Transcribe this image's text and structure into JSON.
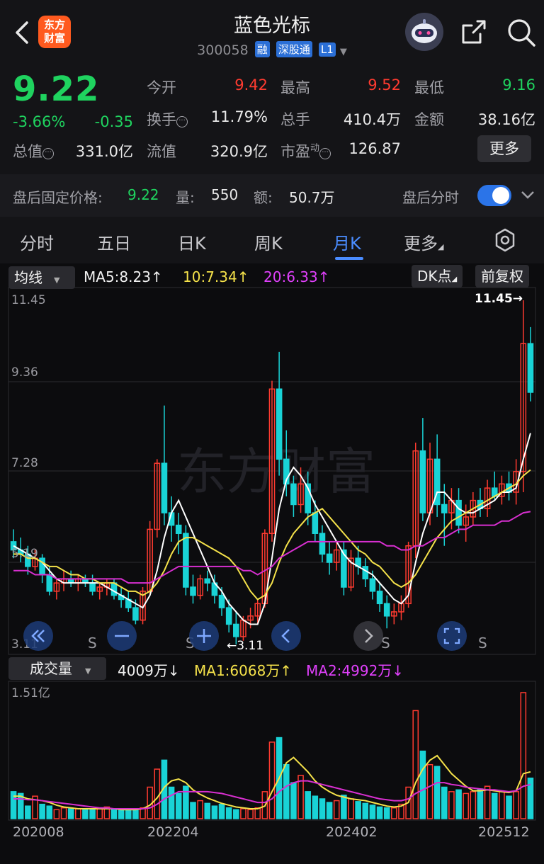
{
  "header": {
    "logo_line1": "东方",
    "logo_line2": "财富",
    "stock_name": "蓝色光标",
    "stock_code": "300058",
    "tags": [
      "融",
      "深股通",
      "L1"
    ]
  },
  "quote": {
    "price": "9.22",
    "change_pct": "-3.66%",
    "change_amt": "-0.35",
    "open_label": "今开",
    "open": "9.42",
    "high_label": "最高",
    "high": "9.52",
    "low_label": "最低",
    "low": "9.16",
    "turnover_label": "换手",
    "turnover": "11.79%",
    "volume_label": "总手",
    "volume": "410.4万",
    "amount_label": "金额",
    "amount": "38.16亿",
    "mktcap_label": "总值",
    "mktcap": "331.0亿",
    "float_label": "流值",
    "float_cap": "320.9亿",
    "pe_label": "市盈",
    "pe_sup": "动",
    "pe": "126.87",
    "more_label": "更多"
  },
  "after_hours": {
    "price_label": "盘后固定价格:",
    "price": "9.22",
    "vol_label": "量:",
    "vol": "550",
    "amt_label": "额:",
    "amt": "50.7万",
    "timeshare_label": "盘后分时"
  },
  "tabs": [
    "分时",
    "五日",
    "日K",
    "周K",
    "月K",
    "更多"
  ],
  "active_tab": "月K",
  "chart_toolbar": {
    "indicator": "均线",
    "ma5": "MA5:8.23↑",
    "ma10": "10:7.34↑",
    "ma20": "20:6.33↑",
    "dk_label": "DK点",
    "adjust_label": "前复权"
  },
  "volume_toolbar": {
    "indicator": "成交量",
    "vol": "4009万↓",
    "ma1": "MA1:6068万↑",
    "ma2": "MA2:4992万↓"
  },
  "colors": {
    "up": "#ff3b30",
    "down": "#19d3d6",
    "ma5": "#ffffff",
    "ma10": "#f5e24a",
    "ma20": "#d82fd0"
  },
  "chart_data": [
    {
      "type": "candlestick",
      "price_axis_labels": [
        "11.45",
        "9.36",
        "7.28",
        "5.19",
        "3.11"
      ],
      "ylim": [
        3.11,
        11.45
      ],
      "max_marker": "11.45→",
      "min_marker": "←3.11",
      "signal_marker": "S",
      "x_labels": [
        "202008",
        "202204",
        "202402",
        "202512"
      ],
      "candles": [
        [
          5.6,
          5.9,
          5.2,
          5.4
        ],
        [
          5.4,
          5.7,
          5.1,
          5.3
        ],
        [
          5.3,
          5.5,
          4.8,
          5.0
        ],
        [
          5.0,
          5.4,
          4.9,
          5.2
        ],
        [
          5.2,
          5.3,
          4.6,
          4.8
        ],
        [
          4.8,
          5.0,
          4.3,
          4.4
        ],
        [
          4.4,
          4.7,
          4.2,
          4.6
        ],
        [
          4.6,
          4.9,
          4.4,
          4.7
        ],
        [
          4.7,
          4.9,
          4.5,
          4.6
        ],
        [
          4.6,
          4.8,
          4.4,
          4.7
        ],
        [
          4.7,
          4.8,
          4.5,
          4.6
        ],
        [
          4.6,
          4.8,
          4.3,
          4.4
        ],
        [
          4.4,
          4.6,
          4.2,
          4.5
        ],
        [
          4.5,
          4.7,
          4.3,
          4.6
        ],
        [
          4.6,
          4.7,
          4.2,
          4.3
        ],
        [
          4.3,
          4.5,
          4.0,
          4.2
        ],
        [
          4.2,
          4.4,
          3.9,
          4.0
        ],
        [
          4.0,
          4.2,
          3.6,
          3.7
        ],
        [
          3.7,
          4.5,
          3.6,
          4.4
        ],
        [
          4.4,
          6.1,
          4.3,
          5.9
        ],
        [
          5.9,
          7.6,
          5.7,
          7.5
        ],
        [
          7.5,
          8.9,
          6.0,
          6.3
        ],
        [
          6.3,
          6.7,
          5.6,
          6.0
        ],
        [
          6.0,
          6.3,
          5.3,
          5.8
        ],
        [
          5.8,
          6.0,
          4.3,
          4.5
        ],
        [
          4.5,
          4.8,
          4.1,
          4.3
        ],
        [
          4.3,
          4.8,
          4.2,
          4.7
        ],
        [
          4.7,
          4.9,
          4.4,
          4.6
        ],
        [
          4.6,
          4.8,
          4.1,
          4.3
        ],
        [
          4.3,
          4.5,
          3.8,
          4.0
        ],
        [
          4.0,
          4.2,
          3.4,
          3.6
        ],
        [
          3.6,
          3.9,
          3.11,
          3.3
        ],
        [
          3.3,
          3.8,
          3.2,
          3.7
        ],
        [
          3.7,
          4.0,
          3.5,
          3.8
        ],
        [
          3.8,
          4.2,
          3.6,
          4.1
        ],
        [
          4.1,
          5.9,
          4.0,
          5.8
        ],
        [
          5.8,
          9.5,
          5.6,
          9.3
        ],
        [
          9.3,
          10.2,
          7.2,
          7.6
        ],
        [
          7.6,
          8.3,
          6.7,
          7.0
        ],
        [
          7.0,
          7.2,
          6.2,
          6.5
        ],
        [
          6.5,
          7.4,
          6.3,
          7.0
        ],
        [
          7.0,
          7.3,
          6.0,
          6.3
        ],
        [
          6.3,
          6.6,
          5.6,
          5.8
        ],
        [
          5.8,
          6.0,
          5.1,
          5.3
        ],
        [
          5.3,
          5.6,
          4.8,
          5.1
        ],
        [
          5.1,
          5.6,
          4.9,
          5.4
        ],
        [
          5.4,
          5.6,
          4.3,
          4.5
        ],
        [
          4.5,
          5.4,
          4.4,
          5.2
        ],
        [
          5.2,
          5.5,
          4.8,
          5.0
        ],
        [
          5.0,
          5.2,
          4.5,
          4.7
        ],
        [
          4.7,
          4.9,
          4.2,
          4.4
        ],
        [
          4.4,
          4.6,
          3.9,
          4.1
        ],
        [
          4.1,
          4.3,
          3.5,
          3.8
        ],
        [
          3.8,
          4.1,
          3.6,
          3.9
        ],
        [
          3.9,
          4.3,
          3.7,
          4.1
        ],
        [
          4.1,
          5.6,
          4.0,
          5.5
        ],
        [
          5.5,
          8.0,
          5.2,
          7.8
        ],
        [
          7.8,
          8.6,
          6.1,
          6.3
        ],
        [
          6.3,
          8.0,
          6.0,
          7.6
        ],
        [
          7.6,
          8.2,
          6.2,
          6.5
        ],
        [
          6.5,
          7.0,
          5.5,
          6.3
        ],
        [
          6.3,
          6.9,
          5.9,
          6.6
        ],
        [
          6.6,
          6.9,
          5.8,
          6.0
        ],
        [
          6.0,
          6.5,
          5.6,
          6.2
        ],
        [
          6.2,
          6.8,
          6.0,
          6.6
        ],
        [
          6.6,
          6.9,
          6.2,
          6.4
        ],
        [
          6.4,
          7.1,
          6.2,
          6.9
        ],
        [
          6.9,
          7.3,
          6.6,
          6.7
        ],
        [
          6.7,
          7.2,
          6.5,
          7.0
        ],
        [
          7.0,
          7.3,
          6.6,
          6.8
        ],
        [
          6.8,
          7.6,
          6.5,
          7.3
        ],
        [
          7.3,
          11.45,
          6.8,
          10.4
        ],
        [
          10.4,
          10.8,
          9.0,
          9.22
        ]
      ],
      "ma5": [
        5.5,
        5.4,
        5.3,
        5.2,
        5.1,
        4.9,
        4.7,
        4.6,
        4.6,
        4.6,
        4.6,
        4.6,
        4.6,
        4.5,
        4.4,
        4.3,
        4.2,
        4.1,
        4.0,
        4.3,
        4.9,
        5.7,
        6.3,
        6.6,
        6.2,
        5.8,
        5.4,
        5.0,
        4.6,
        4.4,
        4.1,
        3.9,
        3.7,
        3.6,
        3.6,
        4.1,
        5.2,
        6.4,
        7.1,
        7.4,
        7.2,
        6.9,
        6.5,
        6.2,
        5.9,
        5.6,
        5.3,
        5.1,
        5.0,
        4.9,
        4.8,
        4.6,
        4.4,
        4.2,
        4.1,
        4.3,
        5.1,
        5.8,
        6.3,
        6.8,
        6.8,
        6.6,
        6.4,
        6.3,
        6.3,
        6.4,
        6.5,
        6.6,
        6.8,
        6.8,
        6.9,
        7.6,
        8.23
      ],
      "ma10": [
        5.3,
        5.3,
        5.2,
        5.2,
        5.1,
        5.0,
        5.0,
        4.9,
        4.8,
        4.8,
        4.7,
        4.7,
        4.6,
        4.6,
        4.6,
        4.5,
        4.4,
        4.4,
        4.3,
        4.4,
        4.6,
        4.9,
        5.3,
        5.6,
        5.7,
        5.7,
        5.6,
        5.5,
        5.4,
        5.3,
        5.2,
        5.0,
        4.7,
        4.4,
        4.2,
        4.3,
        4.6,
        5.1,
        5.5,
        5.8,
        6.0,
        6.2,
        6.3,
        6.4,
        6.2,
        6.0,
        5.8,
        5.6,
        5.4,
        5.3,
        5.1,
        5.0,
        4.8,
        4.6,
        4.5,
        4.6,
        4.8,
        5.1,
        5.4,
        5.7,
        5.9,
        6.1,
        6.2,
        6.3,
        6.4,
        6.5,
        6.6,
        6.7,
        6.8,
        6.9,
        7.0,
        7.2,
        7.34
      ],
      "ma20": [
        4.9,
        4.9,
        4.9,
        4.8,
        4.8,
        4.8,
        4.7,
        4.7,
        4.7,
        4.7,
        4.7,
        4.7,
        4.7,
        4.7,
        4.7,
        4.7,
        4.6,
        4.6,
        4.6,
        4.6,
        4.7,
        4.8,
        4.9,
        5.0,
        5.0,
        5.0,
        5.0,
        5.0,
        5.0,
        5.0,
        5.0,
        5.0,
        4.9,
        4.9,
        4.8,
        4.9,
        5.0,
        5.2,
        5.3,
        5.4,
        5.5,
        5.6,
        5.6,
        5.6,
        5.6,
        5.6,
        5.6,
        5.6,
        5.6,
        5.6,
        5.6,
        5.6,
        5.5,
        5.5,
        5.4,
        5.4,
        5.5,
        5.5,
        5.6,
        5.7,
        5.7,
        5.8,
        5.9,
        5.9,
        6.0,
        6.0,
        6.0,
        6.0,
        6.1,
        6.1,
        6.2,
        6.3,
        6.33
      ]
    },
    {
      "type": "bar",
      "title": "成交量",
      "axis_label": "1.51亿",
      "ylim": [
        0,
        1.51
      ],
      "values": [
        0.3,
        0.28,
        0.14,
        0.25,
        0.16,
        0.14,
        0.1,
        0.12,
        0.11,
        0.11,
        0.1,
        0.1,
        0.12,
        0.13,
        0.11,
        0.1,
        0.09,
        0.1,
        0.12,
        0.35,
        0.55,
        0.65,
        0.35,
        0.28,
        0.36,
        0.18,
        0.2,
        0.17,
        0.14,
        0.16,
        0.12,
        0.1,
        0.11,
        0.1,
        0.12,
        0.3,
        0.85,
        0.9,
        0.6,
        0.4,
        0.48,
        0.3,
        0.25,
        0.22,
        0.18,
        0.2,
        0.26,
        0.22,
        0.19,
        0.17,
        0.15,
        0.13,
        0.12,
        0.12,
        0.16,
        0.35,
        1.2,
        0.75,
        0.6,
        0.58,
        0.35,
        0.3,
        0.32,
        0.28,
        0.3,
        0.33,
        0.36,
        0.28,
        0.3,
        0.25,
        0.3,
        1.4,
        0.45
      ],
      "ma1": [
        0.25,
        0.25,
        0.22,
        0.21,
        0.2,
        0.18,
        0.15,
        0.13,
        0.12,
        0.11,
        0.11,
        0.11,
        0.11,
        0.11,
        0.11,
        0.1,
        0.1,
        0.1,
        0.11,
        0.15,
        0.23,
        0.35,
        0.42,
        0.44,
        0.4,
        0.32,
        0.27,
        0.23,
        0.2,
        0.17,
        0.15,
        0.13,
        0.12,
        0.11,
        0.11,
        0.14,
        0.3,
        0.45,
        0.62,
        0.68,
        0.6,
        0.52,
        0.42,
        0.35,
        0.3,
        0.26,
        0.24,
        0.22,
        0.21,
        0.2,
        0.18,
        0.16,
        0.14,
        0.13,
        0.14,
        0.18,
        0.4,
        0.55,
        0.65,
        0.7,
        0.6,
        0.5,
        0.43,
        0.36,
        0.31,
        0.31,
        0.32,
        0.31,
        0.3,
        0.29,
        0.31,
        0.5,
        0.52
      ],
      "ma2": [
        0.22,
        0.22,
        0.21,
        0.21,
        0.2,
        0.19,
        0.18,
        0.17,
        0.16,
        0.15,
        0.14,
        0.13,
        0.12,
        0.12,
        0.11,
        0.11,
        0.11,
        0.11,
        0.11,
        0.12,
        0.16,
        0.22,
        0.26,
        0.3,
        0.3,
        0.3,
        0.3,
        0.3,
        0.29,
        0.28,
        0.26,
        0.24,
        0.22,
        0.2,
        0.18,
        0.18,
        0.22,
        0.3,
        0.36,
        0.4,
        0.42,
        0.42,
        0.4,
        0.38,
        0.36,
        0.34,
        0.32,
        0.3,
        0.28,
        0.26,
        0.24,
        0.22,
        0.21,
        0.2,
        0.2,
        0.22,
        0.28,
        0.32,
        0.36,
        0.4,
        0.4,
        0.38,
        0.37,
        0.35,
        0.34,
        0.33,
        0.32,
        0.32,
        0.31,
        0.3,
        0.31,
        0.36,
        0.38
      ]
    }
  ]
}
